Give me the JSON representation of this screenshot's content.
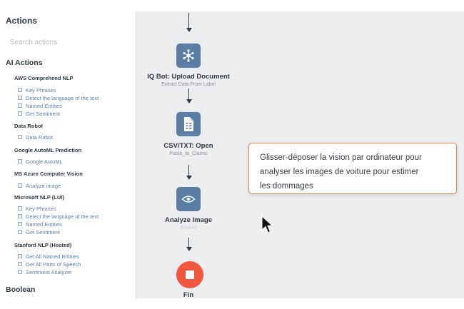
{
  "sidebar": {
    "title": "Actions",
    "search_placeholder": "Search actions",
    "section_ai": "AI Actions",
    "groups": [
      {
        "title": "AWS Comprehend NLP",
        "items": [
          "Key Phrases",
          "Detect the language of the text",
          "Named Entities",
          "Get Sentiment"
        ]
      },
      {
        "title": "Data Robot",
        "items": [
          "Data Robot"
        ]
      },
      {
        "title": "Google AutoML Prediction",
        "items": [
          "Google AutoML"
        ]
      },
      {
        "title": "MS Azure Computer Vision",
        "items": [
          "Analyze image"
        ]
      },
      {
        "title": "Microsoft NLP (LUI)",
        "items": [
          "Key Phrases",
          "Detect the language of the text",
          "Named Entities",
          "Get Sentiment"
        ]
      },
      {
        "title": "Stanford NLP (Hosted)",
        "items": [
          "Get All Named Entities",
          "Get All Parts of Speech",
          "Sentiment Analyzer"
        ]
      }
    ],
    "section_boolean": "Boolean"
  },
  "flow": {
    "nodes": [
      {
        "title": "IQ Bot: Upload Document",
        "subtitle": "Extract Data From Label",
        "icon": "hub-icon"
      },
      {
        "title": "CSV/TXT: Open",
        "subtitle": "Paste_to_Claims",
        "icon": "document-icon"
      },
      {
        "title": "Analyze Image",
        "subtitle": "Ezekiel",
        "icon": "eye-icon"
      }
    ],
    "end_label": "Fin"
  },
  "callout": {
    "lines": [
      "Glisser-déposer la vision par ordinateur pour",
      "analyser les images de voiture pour estimer",
      "les dommages"
    ]
  },
  "colors": {
    "node": "#5c7ea6",
    "stop": "#f1563f",
    "callout_border": "#e8894f",
    "link": "#5a7fa8"
  }
}
